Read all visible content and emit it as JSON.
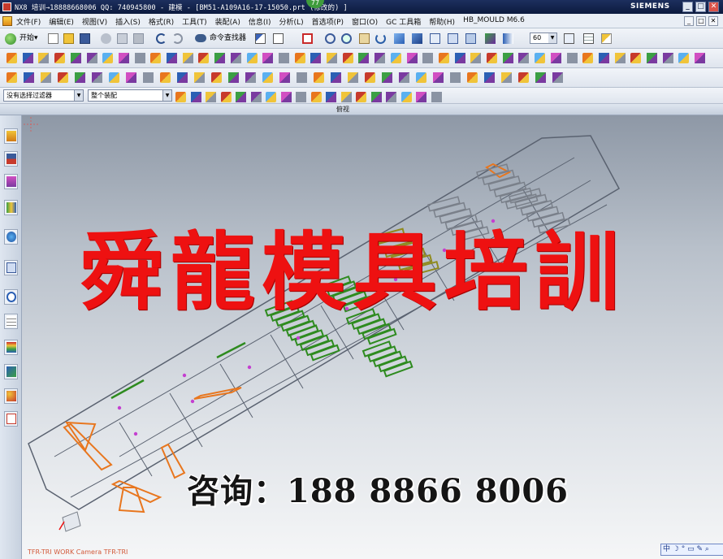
{
  "window": {
    "title": "NX8 培训→18888668006 QQ: 740945800 - 建模 - [BM51-A109A16-17-15050.prt (修改的) ]",
    "badge": "77",
    "brand": "SIEMENS",
    "controls": [
      "_",
      "□",
      "✕"
    ]
  },
  "menubar": {
    "items": [
      "文件(F)",
      "编辑(E)",
      "视图(V)",
      "插入(S)",
      "格式(R)",
      "工具(T)",
      "装配(A)",
      "信息(I)",
      "分析(L)",
      "首选项(P)",
      "窗口(O)",
      "GC 工具箱",
      "帮助(H)",
      "HB_MOULD M6.6"
    ],
    "controls": [
      "_",
      "□",
      "✕"
    ]
  },
  "toolbar1": {
    "start_label": "开始",
    "command_finder_label": "命令查找器",
    "zoom_value": "60"
  },
  "toolbar4": {
    "selection_filter": "没有选择过滤器",
    "assembly_scope": "整个装配"
  },
  "view": {
    "title": "俯视"
  },
  "graphics": {
    "watermark_title": "舜龍模具培訓",
    "watermark_contact": "咨询：188 8866 8006",
    "status_text": "TFR-TRI WORK Camera TFR-TRI",
    "ime_widget": "中 ☽ ° ▭ ✎ ⌕"
  },
  "colors": {
    "title_bar": "#0c1a3e",
    "watermark_red": "#ee1111",
    "part_outline": "#5a6270",
    "orange_parts": "#e8761e",
    "green_parts": "#2e8b1f",
    "olive_parts": "#8f8a1e",
    "magenta_points": "#c43fd0"
  },
  "icons": {
    "toolbar1": [
      "new-file-icon",
      "open-folder-icon",
      "save-icon",
      "cut-icon",
      "copy-icon",
      "paste-icon",
      "undo-icon",
      "redo-icon",
      "command-finder-icon",
      "snap-icon",
      "select-icon",
      "zoom-fit-icon",
      "zoom-icon",
      "zoom-window-icon",
      "rotate-icon",
      "shaded-icon",
      "wireframe-icon",
      "view-cube-icon",
      "section-icon",
      "render-icon",
      "layer-icon",
      "table-icon",
      "drafting-icon"
    ],
    "resource_bar": [
      "assembly-navigator-icon",
      "part-navigator-icon",
      "reuse-library-icon",
      "hd3d-tools-icon",
      "web-browser-icon",
      "history-icon",
      "system-materials-icon",
      "process-studio-icon",
      "roles-icon",
      "sketch-icon",
      "clock-icon"
    ]
  }
}
